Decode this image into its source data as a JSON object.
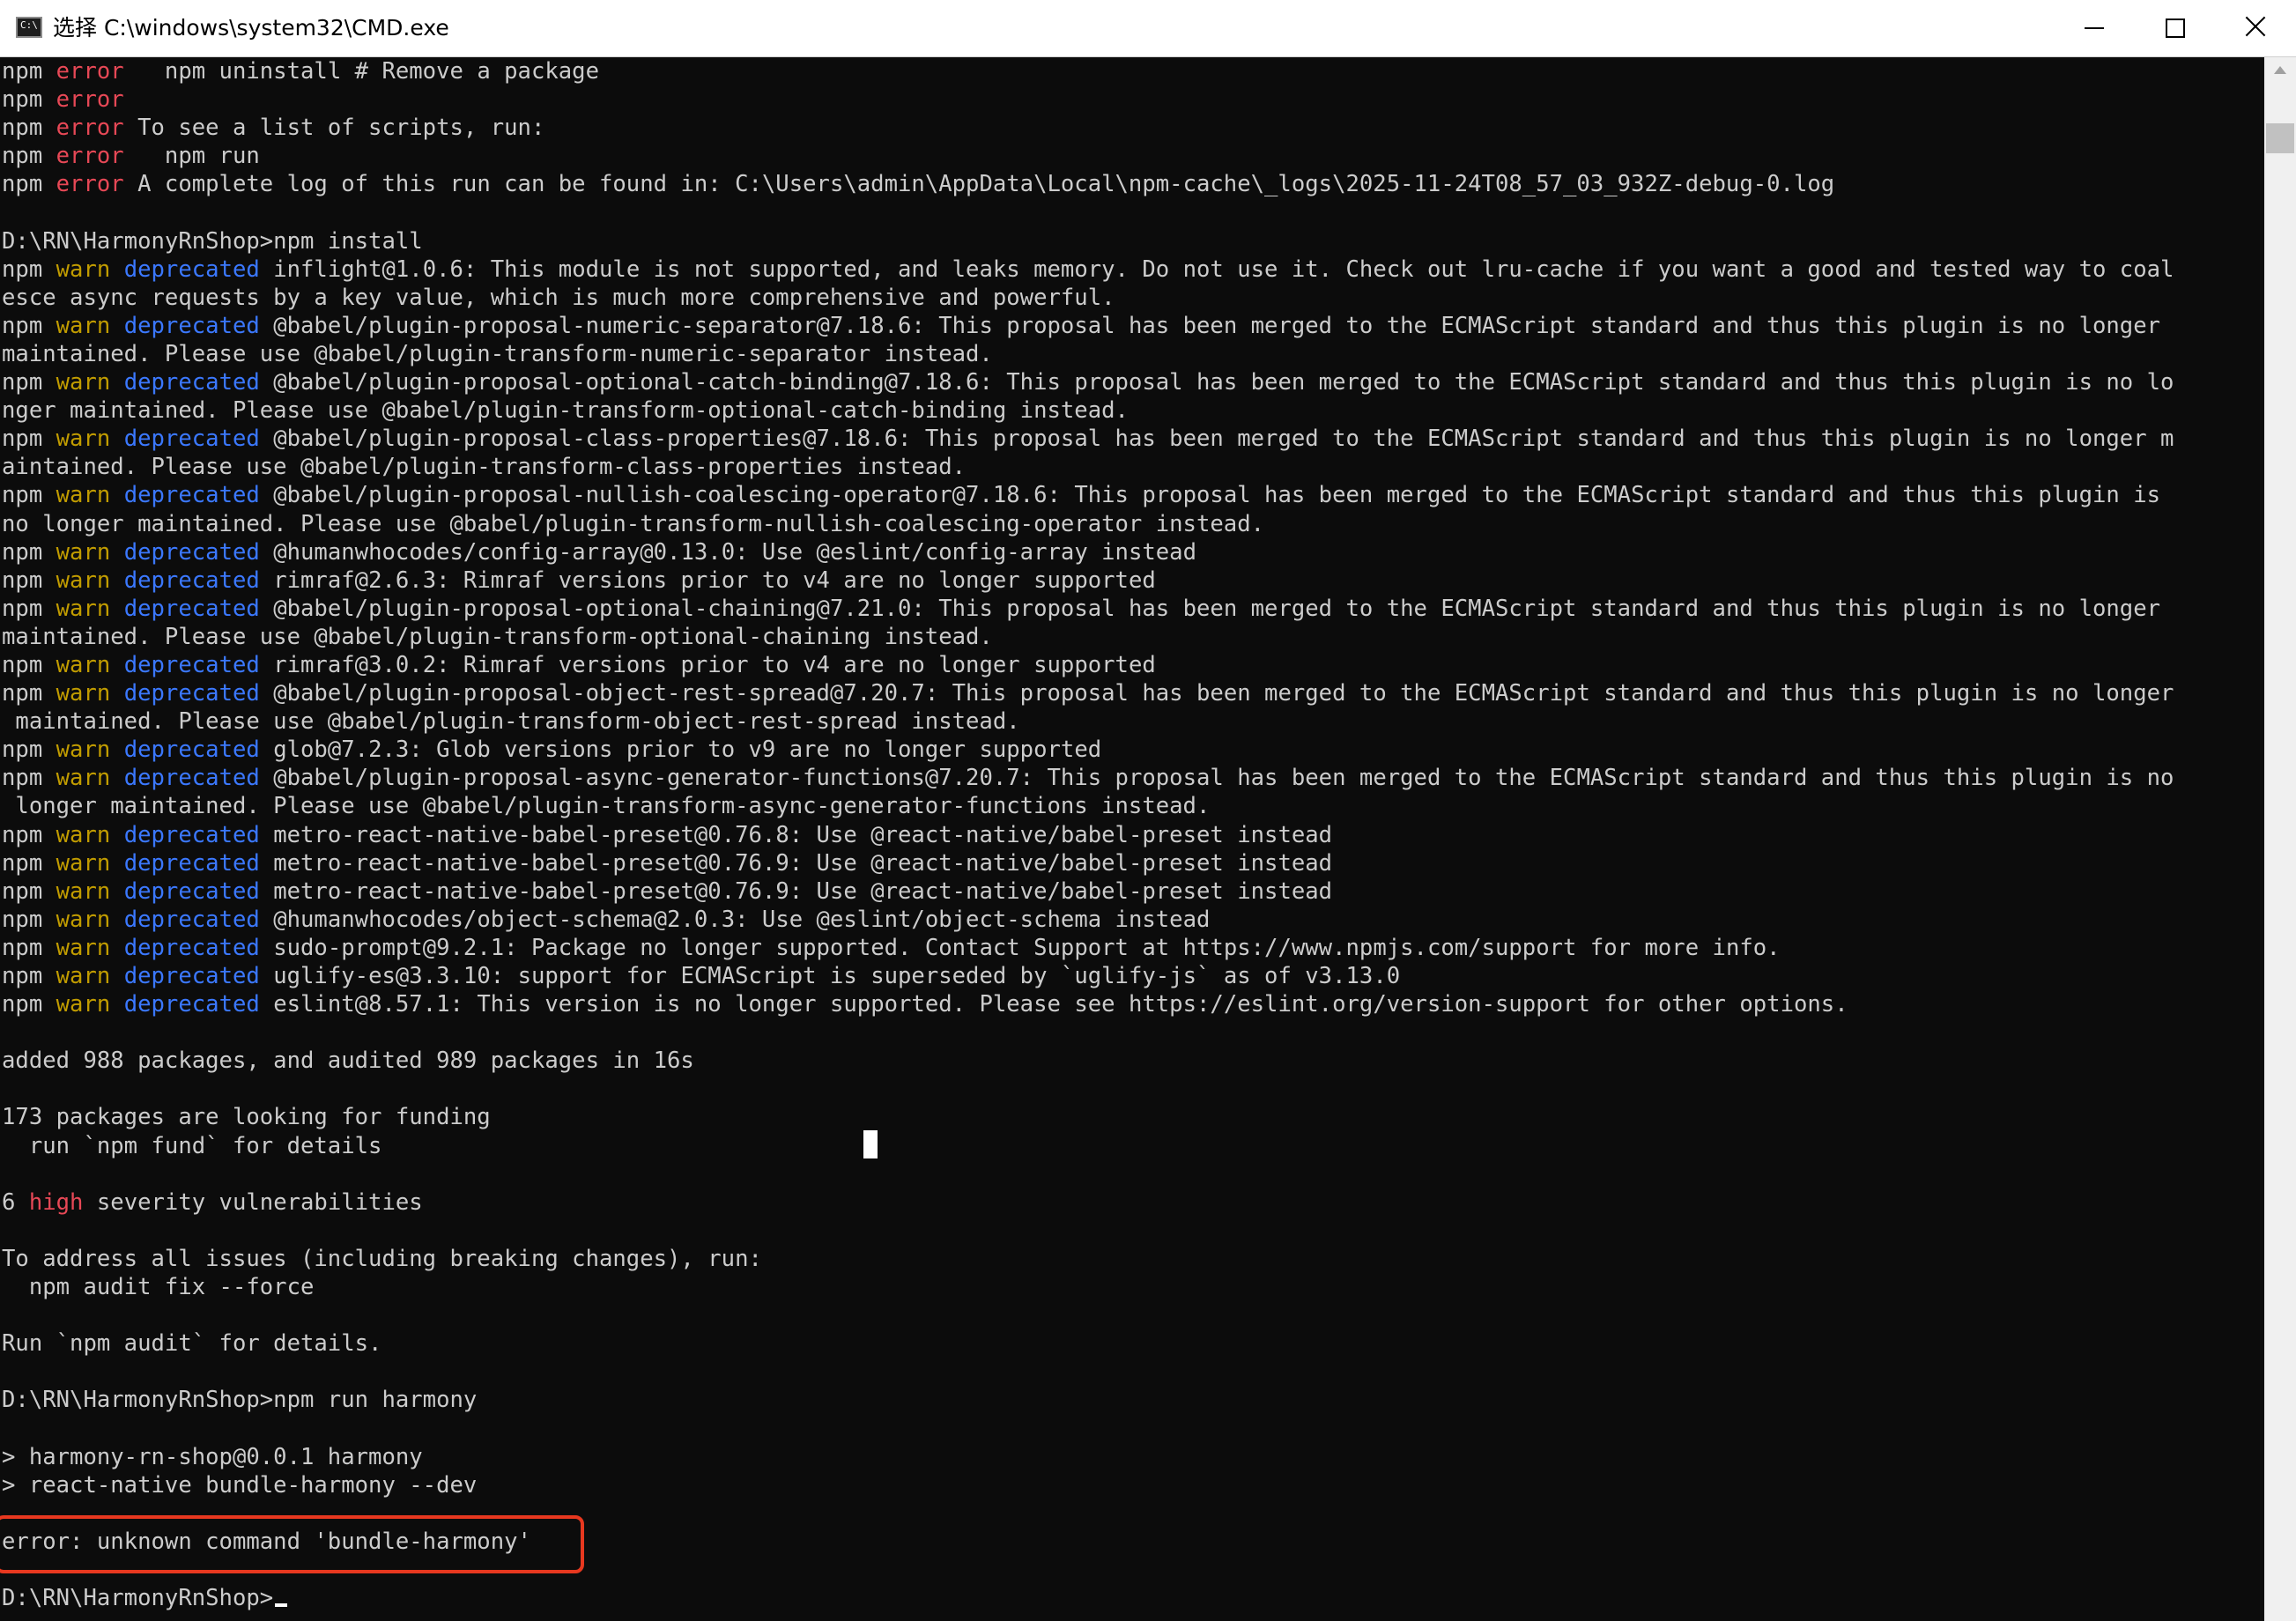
{
  "window": {
    "title": "选择 C:\\windows\\system32\\CMD.exe",
    "icon": "cmd-icon"
  },
  "titlebar_buttons": {
    "minimize": "minimize-icon",
    "maximize": "maximize-icon",
    "close": "close-icon"
  },
  "colors": {
    "background": "#0c0c0c",
    "text": "#cccccc",
    "error": "#e74856",
    "warn": "#c19c00",
    "deprecated": "#3b78ff",
    "highlight_box": "#e8381f"
  },
  "terminal": {
    "lines": [
      [
        [
          "npm ",
          "text"
        ],
        [
          "error",
          "error"
        ],
        [
          "   npm uninstall # Remove a package",
          "text"
        ]
      ],
      [
        [
          "npm ",
          "text"
        ],
        [
          "error",
          "error"
        ]
      ],
      [
        [
          "npm ",
          "text"
        ],
        [
          "error",
          "error"
        ],
        [
          " To see a list of scripts, run:",
          "text"
        ]
      ],
      [
        [
          "npm ",
          "text"
        ],
        [
          "error",
          "error"
        ],
        [
          "   npm run",
          "text"
        ]
      ],
      [
        [
          "npm ",
          "text"
        ],
        [
          "error",
          "error"
        ],
        [
          " A complete log of this run can be found in: C:\\Users\\admin\\AppData\\Local\\npm-cache\\_logs\\2025-11-24T08_57_03_932Z-debug-0.log",
          "text"
        ]
      ],
      [],
      [
        [
          "D:\\RN\\HarmonyRnShop>npm install",
          "text"
        ]
      ],
      [
        [
          "npm ",
          "text"
        ],
        [
          "warn",
          "warn"
        ],
        [
          " ",
          "text"
        ],
        [
          "deprecated",
          "dep"
        ],
        [
          " inflight@1.0.6: This module is not supported, and leaks memory. Do not use it. Check out lru-cache if you want a good and tested way to coal",
          "text"
        ]
      ],
      [
        [
          "esce async requests by a key value, which is much more comprehensive and powerful.",
          "text"
        ]
      ],
      [
        [
          "npm ",
          "text"
        ],
        [
          "warn",
          "warn"
        ],
        [
          " ",
          "text"
        ],
        [
          "deprecated",
          "dep"
        ],
        [
          " @babel/plugin-proposal-numeric-separator@7.18.6: This proposal has been merged to the ECMAScript standard and thus this plugin is no longer",
          "text"
        ]
      ],
      [
        [
          "maintained. Please use @babel/plugin-transform-numeric-separator instead.",
          "text"
        ]
      ],
      [
        [
          "npm ",
          "text"
        ],
        [
          "warn",
          "warn"
        ],
        [
          " ",
          "text"
        ],
        [
          "deprecated",
          "dep"
        ],
        [
          " @babel/plugin-proposal-optional-catch-binding@7.18.6: This proposal has been merged to the ECMAScript standard and thus this plugin is no lo",
          "text"
        ]
      ],
      [
        [
          "nger maintained. Please use @babel/plugin-transform-optional-catch-binding instead.",
          "text"
        ]
      ],
      [
        [
          "npm ",
          "text"
        ],
        [
          "warn",
          "warn"
        ],
        [
          " ",
          "text"
        ],
        [
          "deprecated",
          "dep"
        ],
        [
          " @babel/plugin-proposal-class-properties@7.18.6: This proposal has been merged to the ECMAScript standard and thus this plugin is no longer m",
          "text"
        ]
      ],
      [
        [
          "aintained. Please use @babel/plugin-transform-class-properties instead.",
          "text"
        ]
      ],
      [
        [
          "npm ",
          "text"
        ],
        [
          "warn",
          "warn"
        ],
        [
          " ",
          "text"
        ],
        [
          "deprecated",
          "dep"
        ],
        [
          " @babel/plugin-proposal-nullish-coalescing-operator@7.18.6: This proposal has been merged to the ECMAScript standard and thus this plugin is",
          "text"
        ]
      ],
      [
        [
          "no longer maintained. Please use @babel/plugin-transform-nullish-coalescing-operator instead.",
          "text"
        ]
      ],
      [
        [
          "npm ",
          "text"
        ],
        [
          "warn",
          "warn"
        ],
        [
          " ",
          "text"
        ],
        [
          "deprecated",
          "dep"
        ],
        [
          " @humanwhocodes/config-array@0.13.0: Use @eslint/config-array instead",
          "text"
        ]
      ],
      [
        [
          "npm ",
          "text"
        ],
        [
          "warn",
          "warn"
        ],
        [
          " ",
          "text"
        ],
        [
          "deprecated",
          "dep"
        ],
        [
          " rimraf@2.6.3: Rimraf versions prior to v4 are no longer supported",
          "text"
        ]
      ],
      [
        [
          "npm ",
          "text"
        ],
        [
          "warn",
          "warn"
        ],
        [
          " ",
          "text"
        ],
        [
          "deprecated",
          "dep"
        ],
        [
          " @babel/plugin-proposal-optional-chaining@7.21.0: This proposal has been merged to the ECMAScript standard and thus this plugin is no longer",
          "text"
        ]
      ],
      [
        [
          "maintained. Please use @babel/plugin-transform-optional-chaining instead.",
          "text"
        ]
      ],
      [
        [
          "npm ",
          "text"
        ],
        [
          "warn",
          "warn"
        ],
        [
          " ",
          "text"
        ],
        [
          "deprecated",
          "dep"
        ],
        [
          " rimraf@3.0.2: Rimraf versions prior to v4 are no longer supported",
          "text"
        ]
      ],
      [
        [
          "npm ",
          "text"
        ],
        [
          "warn",
          "warn"
        ],
        [
          " ",
          "text"
        ],
        [
          "deprecated",
          "dep"
        ],
        [
          " @babel/plugin-proposal-object-rest-spread@7.20.7: This proposal has been merged to the ECMAScript standard and thus this plugin is no longer",
          "text"
        ]
      ],
      [
        [
          " maintained. Please use @babel/plugin-transform-object-rest-spread instead.",
          "text"
        ]
      ],
      [
        [
          "npm ",
          "text"
        ],
        [
          "warn",
          "warn"
        ],
        [
          " ",
          "text"
        ],
        [
          "deprecated",
          "dep"
        ],
        [
          " glob@7.2.3: Glob versions prior to v9 are no longer supported",
          "text"
        ]
      ],
      [
        [
          "npm ",
          "text"
        ],
        [
          "warn",
          "warn"
        ],
        [
          " ",
          "text"
        ],
        [
          "deprecated",
          "dep"
        ],
        [
          " @babel/plugin-proposal-async-generator-functions@7.20.7: This proposal has been merged to the ECMAScript standard and thus this plugin is no",
          "text"
        ]
      ],
      [
        [
          " longer maintained. Please use @babel/plugin-transform-async-generator-functions instead.",
          "text"
        ]
      ],
      [
        [
          "npm ",
          "text"
        ],
        [
          "warn",
          "warn"
        ],
        [
          " ",
          "text"
        ],
        [
          "deprecated",
          "dep"
        ],
        [
          " metro-react-native-babel-preset@0.76.8: Use @react-native/babel-preset instead",
          "text"
        ]
      ],
      [
        [
          "npm ",
          "text"
        ],
        [
          "warn",
          "warn"
        ],
        [
          " ",
          "text"
        ],
        [
          "deprecated",
          "dep"
        ],
        [
          " metro-react-native-babel-preset@0.76.9: Use @react-native/babel-preset instead",
          "text"
        ]
      ],
      [
        [
          "npm ",
          "text"
        ],
        [
          "warn",
          "warn"
        ],
        [
          " ",
          "text"
        ],
        [
          "deprecated",
          "dep"
        ],
        [
          " metro-react-native-babel-preset@0.76.9: Use @react-native/babel-preset instead",
          "text"
        ]
      ],
      [
        [
          "npm ",
          "text"
        ],
        [
          "warn",
          "warn"
        ],
        [
          " ",
          "text"
        ],
        [
          "deprecated",
          "dep"
        ],
        [
          " @humanwhocodes/object-schema@2.0.3: Use @eslint/object-schema instead",
          "text"
        ]
      ],
      [
        [
          "npm ",
          "text"
        ],
        [
          "warn",
          "warn"
        ],
        [
          " ",
          "text"
        ],
        [
          "deprecated",
          "dep"
        ],
        [
          " sudo-prompt@9.2.1: Package no longer supported. Contact Support at https://www.npmjs.com/support for more info.",
          "text"
        ]
      ],
      [
        [
          "npm ",
          "text"
        ],
        [
          "warn",
          "warn"
        ],
        [
          " ",
          "text"
        ],
        [
          "deprecated",
          "dep"
        ],
        [
          " uglify-es@3.3.10: support for ECMAScript is superseded by `uglify-js` as of v3.13.0",
          "text"
        ]
      ],
      [
        [
          "npm ",
          "text"
        ],
        [
          "warn",
          "warn"
        ],
        [
          " ",
          "text"
        ],
        [
          "deprecated",
          "dep"
        ],
        [
          " eslint@8.57.1: This version is no longer supported. Please see https://eslint.org/version-support for other options.",
          "text"
        ]
      ],
      [],
      [
        [
          "added 988 packages, and audited 989 packages in 16s",
          "text"
        ]
      ],
      [],
      [
        [
          "173 packages are looking for funding",
          "text"
        ]
      ],
      [
        [
          "  run `npm fund` for details",
          "text"
        ]
      ],
      [],
      [
        [
          "6 ",
          "text"
        ],
        [
          "high",
          "high"
        ],
        [
          " severity vulnerabilities",
          "text"
        ]
      ],
      [],
      [
        [
          "To address all issues (including breaking changes), run:",
          "text"
        ]
      ],
      [
        [
          "  npm audit fix --force",
          "text"
        ]
      ],
      [],
      [
        [
          "Run `npm audit` for details.",
          "text"
        ]
      ],
      [],
      [
        [
          "D:\\RN\\HarmonyRnShop>npm run harmony",
          "text"
        ]
      ],
      [],
      [
        [
          "> harmony-rn-shop@0.0.1 harmony",
          "text"
        ]
      ],
      [
        [
          "> react-native bundle-harmony --dev",
          "text"
        ]
      ],
      [],
      [
        [
          "error: unknown command 'bundle-harmony'",
          "text"
        ]
      ],
      [],
      [
        [
          "D:\\RN\\HarmonyRnShop>",
          "text"
        ]
      ]
    ]
  }
}
